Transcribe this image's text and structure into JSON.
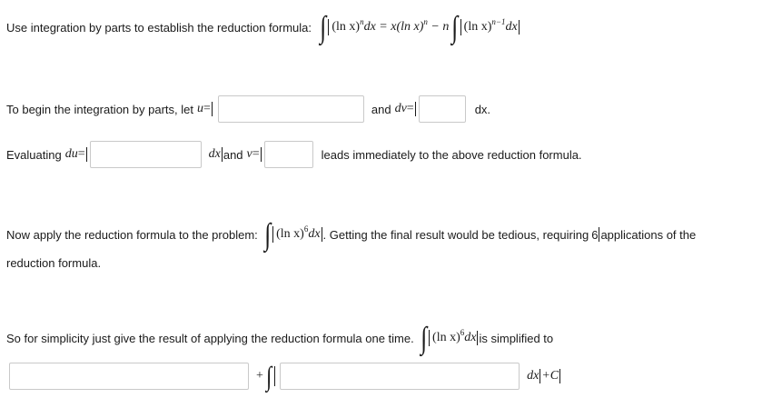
{
  "row1": {
    "intro": "Use integration by parts to establish the reduction formula:",
    "formula_ln": "(ln x)",
    "formula_n": "n",
    "formula_dx_eq": "dx = x(ln x)",
    "formula_n2": "n",
    "formula_minus_n": " − n",
    "formula_ln2": "(ln x)",
    "formula_exp": "n−1",
    "formula_dx": "dx"
  },
  "row2": {
    "prefix": "To begin the integration by parts, let",
    "u_var": "u",
    "equals": " =",
    "and_dv": "and",
    "dv_var": "dv",
    "equals2": " =",
    "dx": "dx."
  },
  "row3": {
    "prefix": "Evaluating",
    "du_var": "du",
    "equals": " =",
    "dx_and": "dx",
    "and_v": " and",
    "v_var": "v",
    "equals2": " =",
    "suffix": "leads immediately to the above reduction formula."
  },
  "row4": {
    "prefix": "Now apply the reduction formula to the problem:",
    "ln": "(ln x)",
    "exp": "6",
    "dx": "dx",
    "middle": ". Getting the final result would be tedious, requiring",
    "count": "6",
    "suffix": "applications of the",
    "line2": "reduction formula."
  },
  "row5": {
    "prefix": "So for simplicity just give the result of applying the reduction formula one time.",
    "ln": "(ln x)",
    "exp": "6",
    "dx": "dx",
    "suffix": "is simplified to"
  },
  "row6": {
    "plus": "+",
    "dx": "dx",
    "plus_c": "+C"
  },
  "inputs": {
    "u_value": "",
    "dv_value": "",
    "du_value": "",
    "v_value": "",
    "answer_first_value": "",
    "answer_integrand_value": ""
  }
}
